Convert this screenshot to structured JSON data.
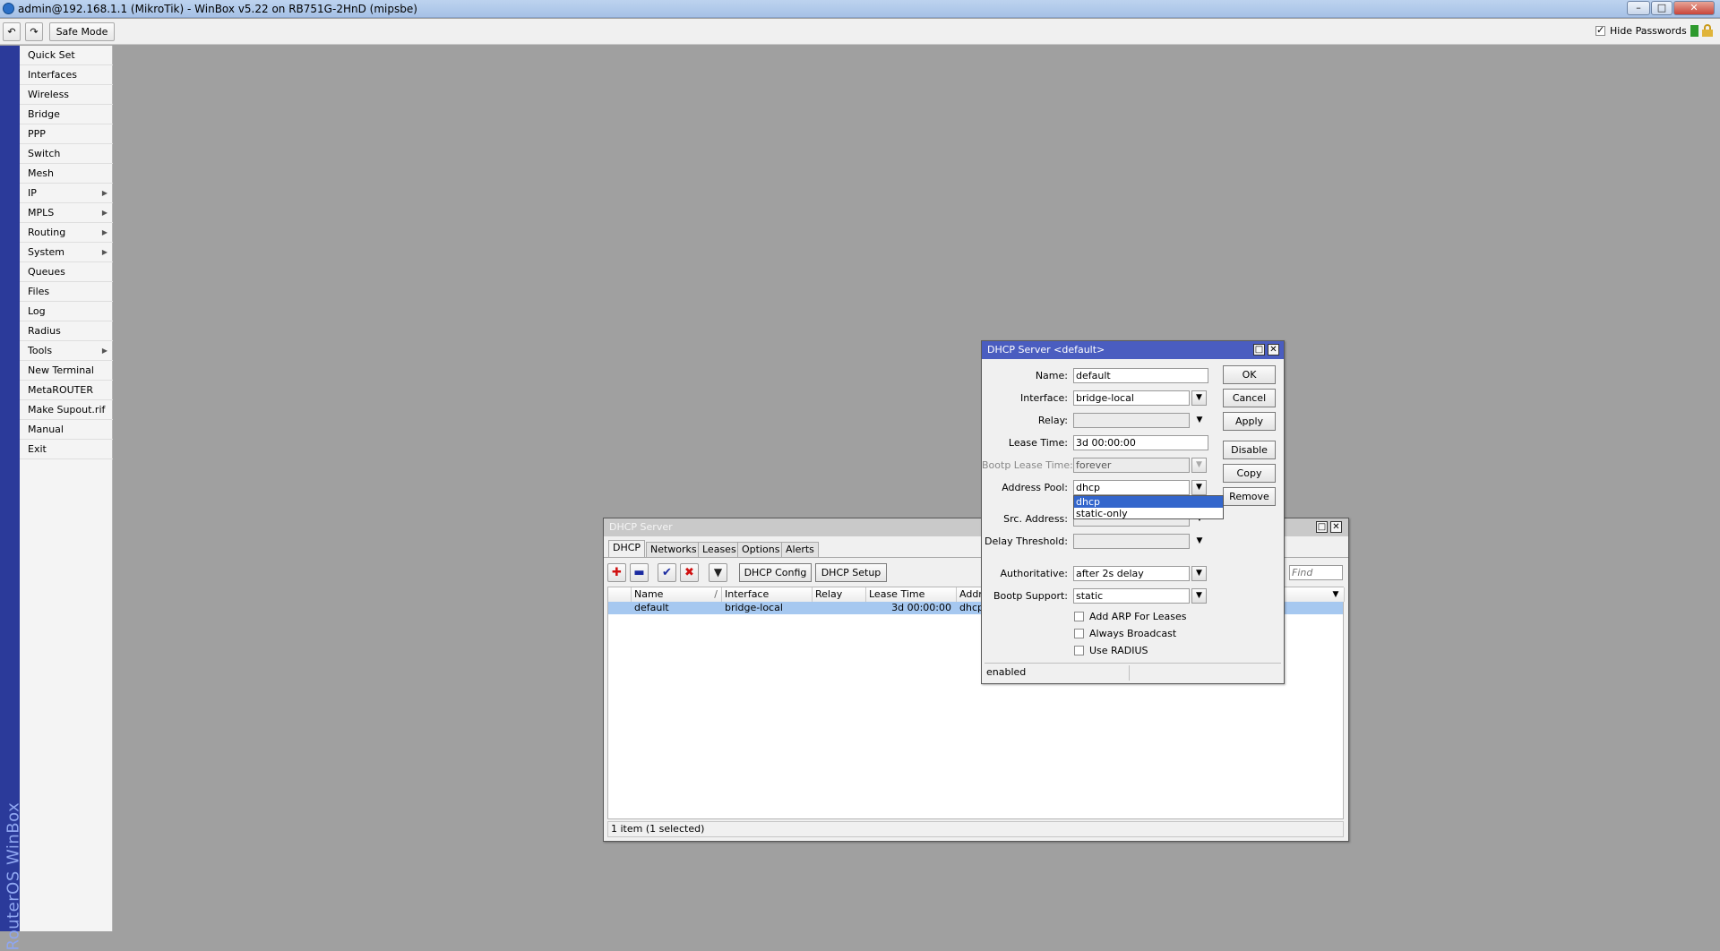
{
  "app": {
    "window_title": "admin@192.168.1.1 (MikroTik) - WinBox v5.22 on RB751G-2HnD (mipsbe)",
    "brand_vertical": "RouterOS WinBox"
  },
  "toolbar": {
    "undo_icon": "undo-icon",
    "redo_icon": "redo-icon",
    "safe_mode_label": "Safe Mode",
    "hide_passwords_label": "Hide Passwords",
    "hide_passwords_checked": true
  },
  "menu": {
    "items": [
      {
        "label": "Quick Set",
        "submenu": false
      },
      {
        "label": "Interfaces",
        "submenu": false
      },
      {
        "label": "Wireless",
        "submenu": false
      },
      {
        "label": "Bridge",
        "submenu": false
      },
      {
        "label": "PPP",
        "submenu": false
      },
      {
        "label": "Switch",
        "submenu": false
      },
      {
        "label": "Mesh",
        "submenu": false
      },
      {
        "label": "IP",
        "submenu": true
      },
      {
        "label": "MPLS",
        "submenu": true
      },
      {
        "label": "Routing",
        "submenu": true
      },
      {
        "label": "System",
        "submenu": true
      },
      {
        "label": "Queues",
        "submenu": false
      },
      {
        "label": "Files",
        "submenu": false
      },
      {
        "label": "Log",
        "submenu": false
      },
      {
        "label": "Radius",
        "submenu": false
      },
      {
        "label": "Tools",
        "submenu": true
      },
      {
        "label": "New Terminal",
        "submenu": false
      },
      {
        "label": "MetaROUTER",
        "submenu": false
      },
      {
        "label": "Make Supout.rif",
        "submenu": false
      },
      {
        "label": "Manual",
        "submenu": false
      },
      {
        "label": "Exit",
        "submenu": false
      }
    ]
  },
  "dhcp_server_window": {
    "title": "DHCP Server",
    "tabs": [
      "DHCP",
      "Networks",
      "Leases",
      "Options",
      "Alerts"
    ],
    "active_tab": "DHCP",
    "buttons": {
      "dhcp_config": "DHCP Config",
      "dhcp_setup": "DHCP Setup"
    },
    "find_placeholder": "Find",
    "columns": [
      "Name",
      "Interface",
      "Relay",
      "Lease Time",
      "Addre"
    ],
    "sort_indicator": "/",
    "rows": [
      {
        "name": "default",
        "interface": "bridge-local",
        "relay": "",
        "lease_time": "3d 00:00:00",
        "address_pool": "dhcp",
        "selected": true
      }
    ],
    "status": "1 item (1 selected)"
  },
  "dhcp_default_dialog": {
    "title": "DHCP Server <default>",
    "fields": {
      "name_label": "Name:",
      "name_value": "default",
      "interface_label": "Interface:",
      "interface_value": "bridge-local",
      "relay_label": "Relay:",
      "relay_value": "",
      "lease_time_label": "Lease Time:",
      "lease_time_value": "3d 00:00:00",
      "bootp_lease_time_label": "Bootp Lease Time:",
      "bootp_lease_time_value": "forever",
      "address_pool_label": "Address Pool:",
      "address_pool_value": "dhcp",
      "src_address_label": "Src. Address:",
      "src_address_value": "",
      "delay_threshold_label": "Delay Threshold:",
      "delay_threshold_value": "",
      "authoritative_label": "Authoritative:",
      "authoritative_value": "after 2s delay",
      "bootp_support_label": "Bootp Support:",
      "bootp_support_value": "static"
    },
    "checkboxes": [
      {
        "label": "Add ARP For Leases",
        "checked": false
      },
      {
        "label": "Always Broadcast",
        "checked": false
      },
      {
        "label": "Use RADIUS",
        "checked": false
      }
    ],
    "buttons": {
      "ok": "OK",
      "cancel": "Cancel",
      "apply": "Apply",
      "disable": "Disable",
      "copy": "Copy",
      "remove": "Remove"
    },
    "address_pool_dropdown": {
      "options": [
        "dhcp",
        "static-only"
      ],
      "highlighted": "dhcp"
    },
    "status": "enabled"
  },
  "colors": {
    "accent_strip": "#2b3a9a",
    "selection": "#a6c8f0",
    "dialog_title": "#4a5dc0"
  }
}
